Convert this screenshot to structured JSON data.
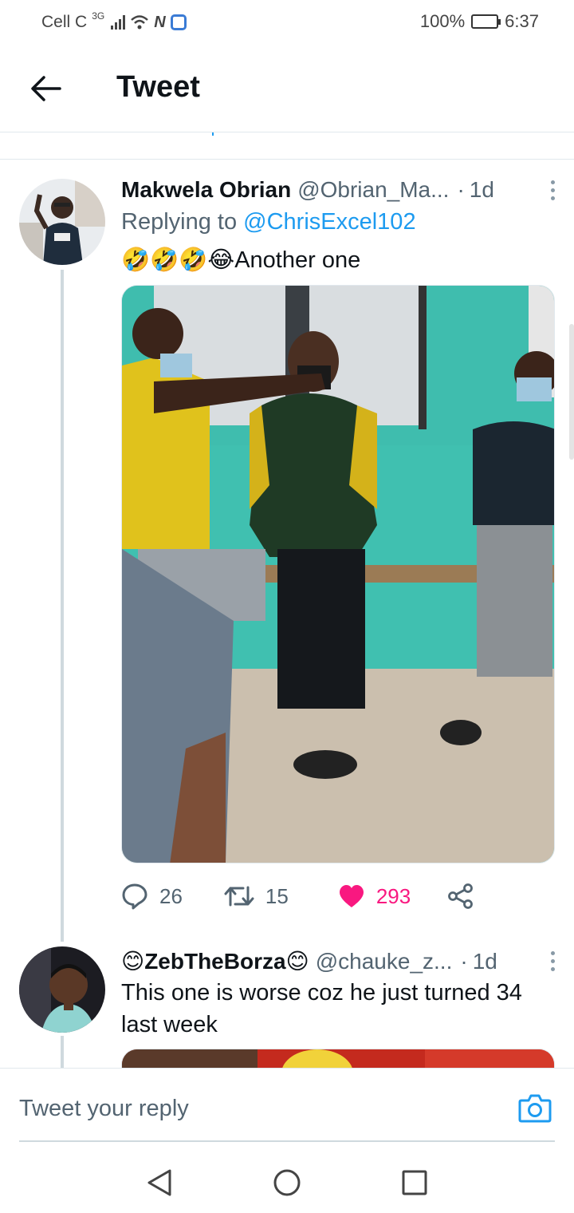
{
  "status_bar": {
    "carrier": "Cell C",
    "network": "3G",
    "battery": "100%",
    "time": "6:37"
  },
  "header": {
    "title": "Tweet"
  },
  "tweets": [
    {
      "name": "Makwela Obrian",
      "handle": "@Obrian_Ma...",
      "time": "1d",
      "reply_prefix": "Replying to",
      "reply_mention": "@ChrisExcel102",
      "text": "🤣🤣🤣😂Another one",
      "replies": "26",
      "retweets": "15",
      "likes": "293"
    },
    {
      "name": "😊ZebTheBorza😊",
      "handle": "@chauke_z...",
      "time": "1d",
      "text": "This one is worse coz he just turned 34 last week"
    }
  ],
  "reply_bar": {
    "placeholder": "Tweet your reply"
  },
  "colors": {
    "link": "#1d9bf0",
    "like": "#f91880",
    "muted": "#536471"
  }
}
